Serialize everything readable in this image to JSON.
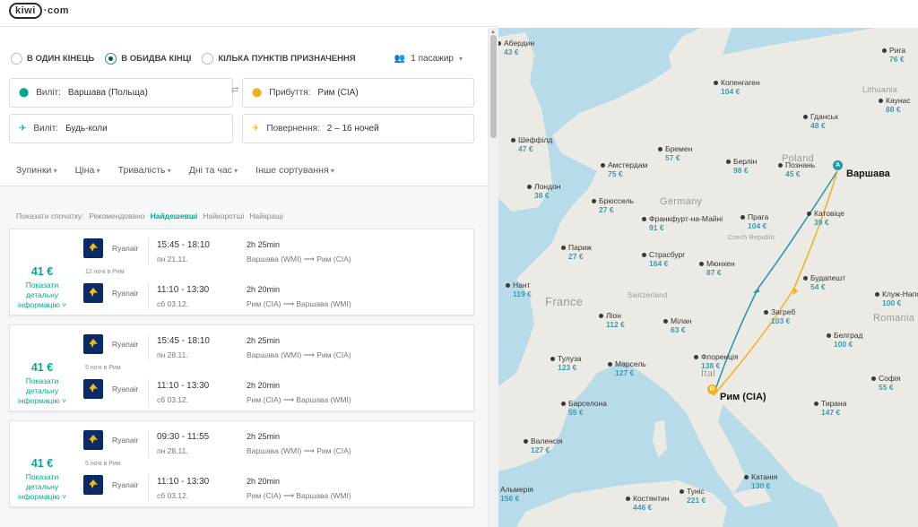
{
  "header": {
    "logo": "kiwi",
    "logo_suffix": "·com"
  },
  "trip_type": {
    "options": [
      "В ОДИН КІНЕЦЬ",
      "В ОБИДВА КІНЦІ",
      "КІЛЬКА ПУНКТІВ ПРИЗНАЧЕННЯ"
    ],
    "selected": "В ОБИДВА КІНЦІ"
  },
  "passengers": "1 пасажир",
  "search": {
    "from_label": "Виліт:",
    "from_value": "Варшава (Польща)",
    "to_label": "Прибуття:",
    "to_value": "Рим (CIA)",
    "depart_label": "Виліт:",
    "depart_value": "Будь-коли",
    "return_label": "Повернення:",
    "return_value": "2 – 16 ночей"
  },
  "filters": [
    "Зупинки",
    "Ціна",
    "Тривалість",
    "Дні та час",
    "Інше сортування"
  ],
  "sort": {
    "prefix": "Показати спочатку:",
    "options": [
      "Рекомендовано",
      "Найдешевші",
      "Найкоротші",
      "Найкращі"
    ],
    "active": "Найдешевші"
  },
  "results": [
    {
      "price": "41 €",
      "details": "Показати детальну інформацію ˅",
      "nights": "12 ночі в Рим",
      "out": {
        "airline": "Ryanair",
        "time": "15:45 - 18:10",
        "date": "пн 21.11.",
        "duration": "2h 25min",
        "from": "Варшава (WMI)",
        "to": "Рим (CIA)"
      },
      "back": {
        "airline": "Ryanair",
        "time": "11:10 - 13:30",
        "date": "сб 03.12.",
        "duration": "2h 20min",
        "from": "Рим (CIA)",
        "to": "Варшава (WMI)"
      }
    },
    {
      "price": "41 €",
      "details": "Показати детальну інформацію ˅",
      "nights": "5 ночі в Рим",
      "out": {
        "airline": "Ryanair",
        "time": "15:45 - 18:10",
        "date": "пн 28.11.",
        "duration": "2h 25min",
        "from": "Варшава (WMI)",
        "to": "Рим (CIA)"
      },
      "back": {
        "airline": "Ryanair",
        "time": "11:10 - 13:30",
        "date": "сб 03.12.",
        "duration": "2h 20min",
        "from": "Рим (CIA)",
        "to": "Варшава (WMI)"
      }
    },
    {
      "price": "41 €",
      "details": "Показати детальну інформацію ˅",
      "nights": "5 ночі в Рим",
      "out": {
        "airline": "Ryanair",
        "time": "09:30 - 11:55",
        "date": "пн 28.11.",
        "duration": "2h 25min",
        "from": "Варшава (WMI)",
        "to": "Рим (CIA)"
      },
      "back": {
        "airline": "Ryanair",
        "time": "11:10 - 13:30",
        "date": "сб 03.12.",
        "duration": "2h 20min",
        "from": "Рим (CIA)",
        "to": "Варшава (WMI)"
      }
    }
  ],
  "map": {
    "origin": "Варшава",
    "destination": "Рим (CIA)",
    "countries": [
      "Germany",
      "France",
      "Poland",
      "Romania",
      "Lithuania",
      "Czech Republic",
      "Switzerland",
      "Ital"
    ],
    "cities": [
      {
        "name": "Абердин",
        "price": "43 €"
      },
      {
        "name": "Копенгаген",
        "price": "104 €"
      },
      {
        "name": "Рига",
        "price": "76 €"
      },
      {
        "name": "Каунас",
        "price": "88 €"
      },
      {
        "name": "Гданськ",
        "price": "48 €"
      },
      {
        "name": "Шеффілд",
        "price": "47 €"
      },
      {
        "name": "Бремен",
        "price": "57 €"
      },
      {
        "name": "Берлін",
        "price": "98 €"
      },
      {
        "name": "Познань",
        "price": "45 €"
      },
      {
        "name": "Амстердам",
        "price": "75 €"
      },
      {
        "name": "Лондон",
        "price": "38 €"
      },
      {
        "name": "Брюссель",
        "price": "27 €"
      },
      {
        "name": "Франкфурт-на-Майні",
        "price": "91 €"
      },
      {
        "name": "Прага",
        "price": "104 €"
      },
      {
        "name": "Катовіце",
        "price": "39 €"
      },
      {
        "name": "Париж",
        "price": "27 €"
      },
      {
        "name": "Страсбург",
        "price": "164 €"
      },
      {
        "name": "Мюнхен",
        "price": "87 €"
      },
      {
        "name": "Будапешт",
        "price": "54 €"
      },
      {
        "name": "Нант",
        "price": "119 €"
      },
      {
        "name": "Клуж-Напо",
        "price": "100 €"
      },
      {
        "name": "Ліон",
        "price": "112 €"
      },
      {
        "name": "Мілан",
        "price": "63 €"
      },
      {
        "name": "Загреб",
        "price": "103 €"
      },
      {
        "name": "Белград",
        "price": "100 €"
      },
      {
        "name": "Тулуза",
        "price": "123 €"
      },
      {
        "name": "Марсель",
        "price": "127 €"
      },
      {
        "name": "Флоренція",
        "price": "138 €"
      },
      {
        "name": "Софія",
        "price": "55 €"
      },
      {
        "name": "Барселона",
        "price": "55 €"
      },
      {
        "name": "Тирана",
        "price": "147 €"
      },
      {
        "name": "Валенсія",
        "price": "127 €"
      },
      {
        "name": "Катанія",
        "price": "130 €"
      },
      {
        "name": "Альмерія",
        "price": "156 €"
      },
      {
        "name": "Костянтин",
        "price": "446 €"
      },
      {
        "name": "Туніс",
        "price": "221 €"
      }
    ],
    "colors": {
      "water": "#b7dbe8",
      "land": "#eceae4",
      "route_out": "#1b9aaa",
      "route_back": "#f2b01e"
    }
  }
}
